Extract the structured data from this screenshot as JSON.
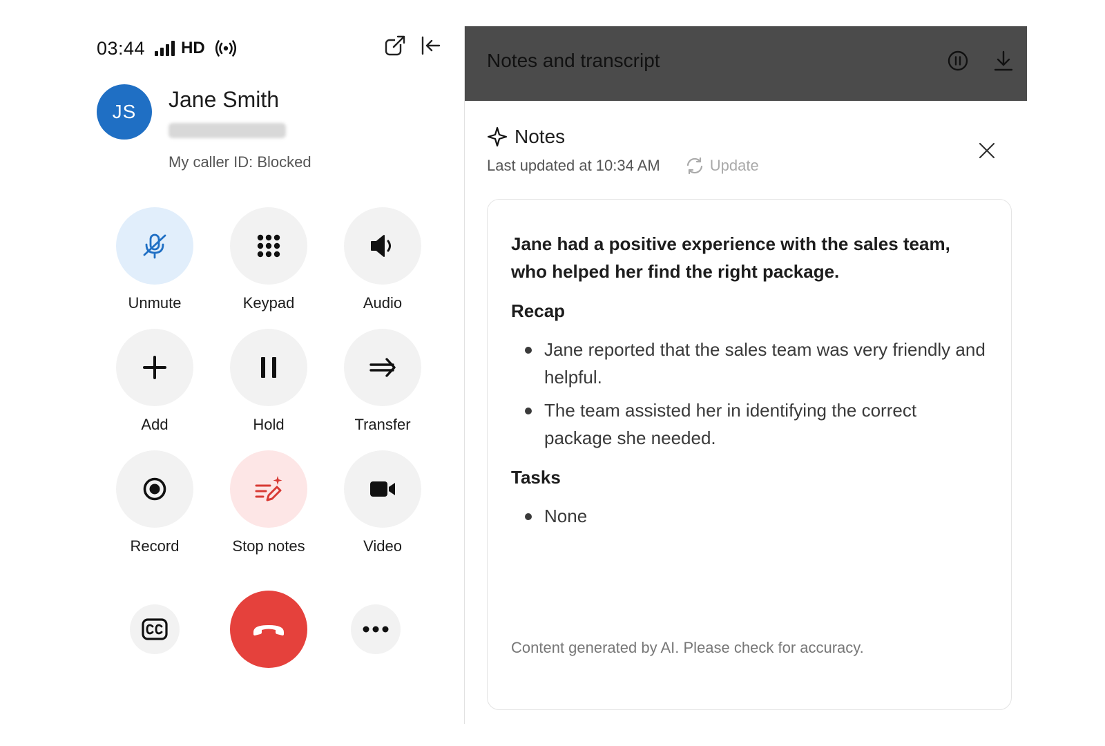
{
  "status_bar": {
    "time": "03:44",
    "network_label": "HD"
  },
  "contact": {
    "initials": "JS",
    "name": "Jane Smith",
    "caller_id": "My caller ID: Blocked",
    "avatar_color": "#1f6fc4"
  },
  "actions": [
    {
      "label": "Unmute",
      "icon": "mic-off-icon",
      "state": "active"
    },
    {
      "label": "Keypad",
      "icon": "keypad-icon"
    },
    {
      "label": "Audio",
      "icon": "speaker-icon"
    },
    {
      "label": "Add",
      "icon": "plus-icon"
    },
    {
      "label": "Hold",
      "icon": "pause-icon"
    },
    {
      "label": "Transfer",
      "icon": "transfer-icon"
    },
    {
      "label": "Record",
      "icon": "record-icon"
    },
    {
      "label": "Stop notes",
      "icon": "ai-notes-icon",
      "state": "active"
    },
    {
      "label": "Video",
      "icon": "video-icon"
    }
  ],
  "bottom_actions": {
    "captions_icon": "cc-icon",
    "hangup_icon": "hang-up-icon",
    "hangup_color": "#e5413c",
    "more_icon": "more-icon"
  },
  "notes_panel": {
    "title": "Notes and transcript",
    "header_color": "#4b4b4b",
    "notes_title": "Notes",
    "last_updated": "Last updated at 10:34 AM",
    "update_label": "Update",
    "summary": "Jane had a positive experience with the sales team, who helped her find the right package.",
    "recap_title": "Recap",
    "recap_items": [
      "Jane reported that the sales team was very friendly and helpful.",
      "The team assisted her in identifying the correct package she needed."
    ],
    "tasks_title": "Tasks",
    "task_items": [
      "None"
    ],
    "disclaimer": "Content generated by AI. Please check for accuracy."
  }
}
